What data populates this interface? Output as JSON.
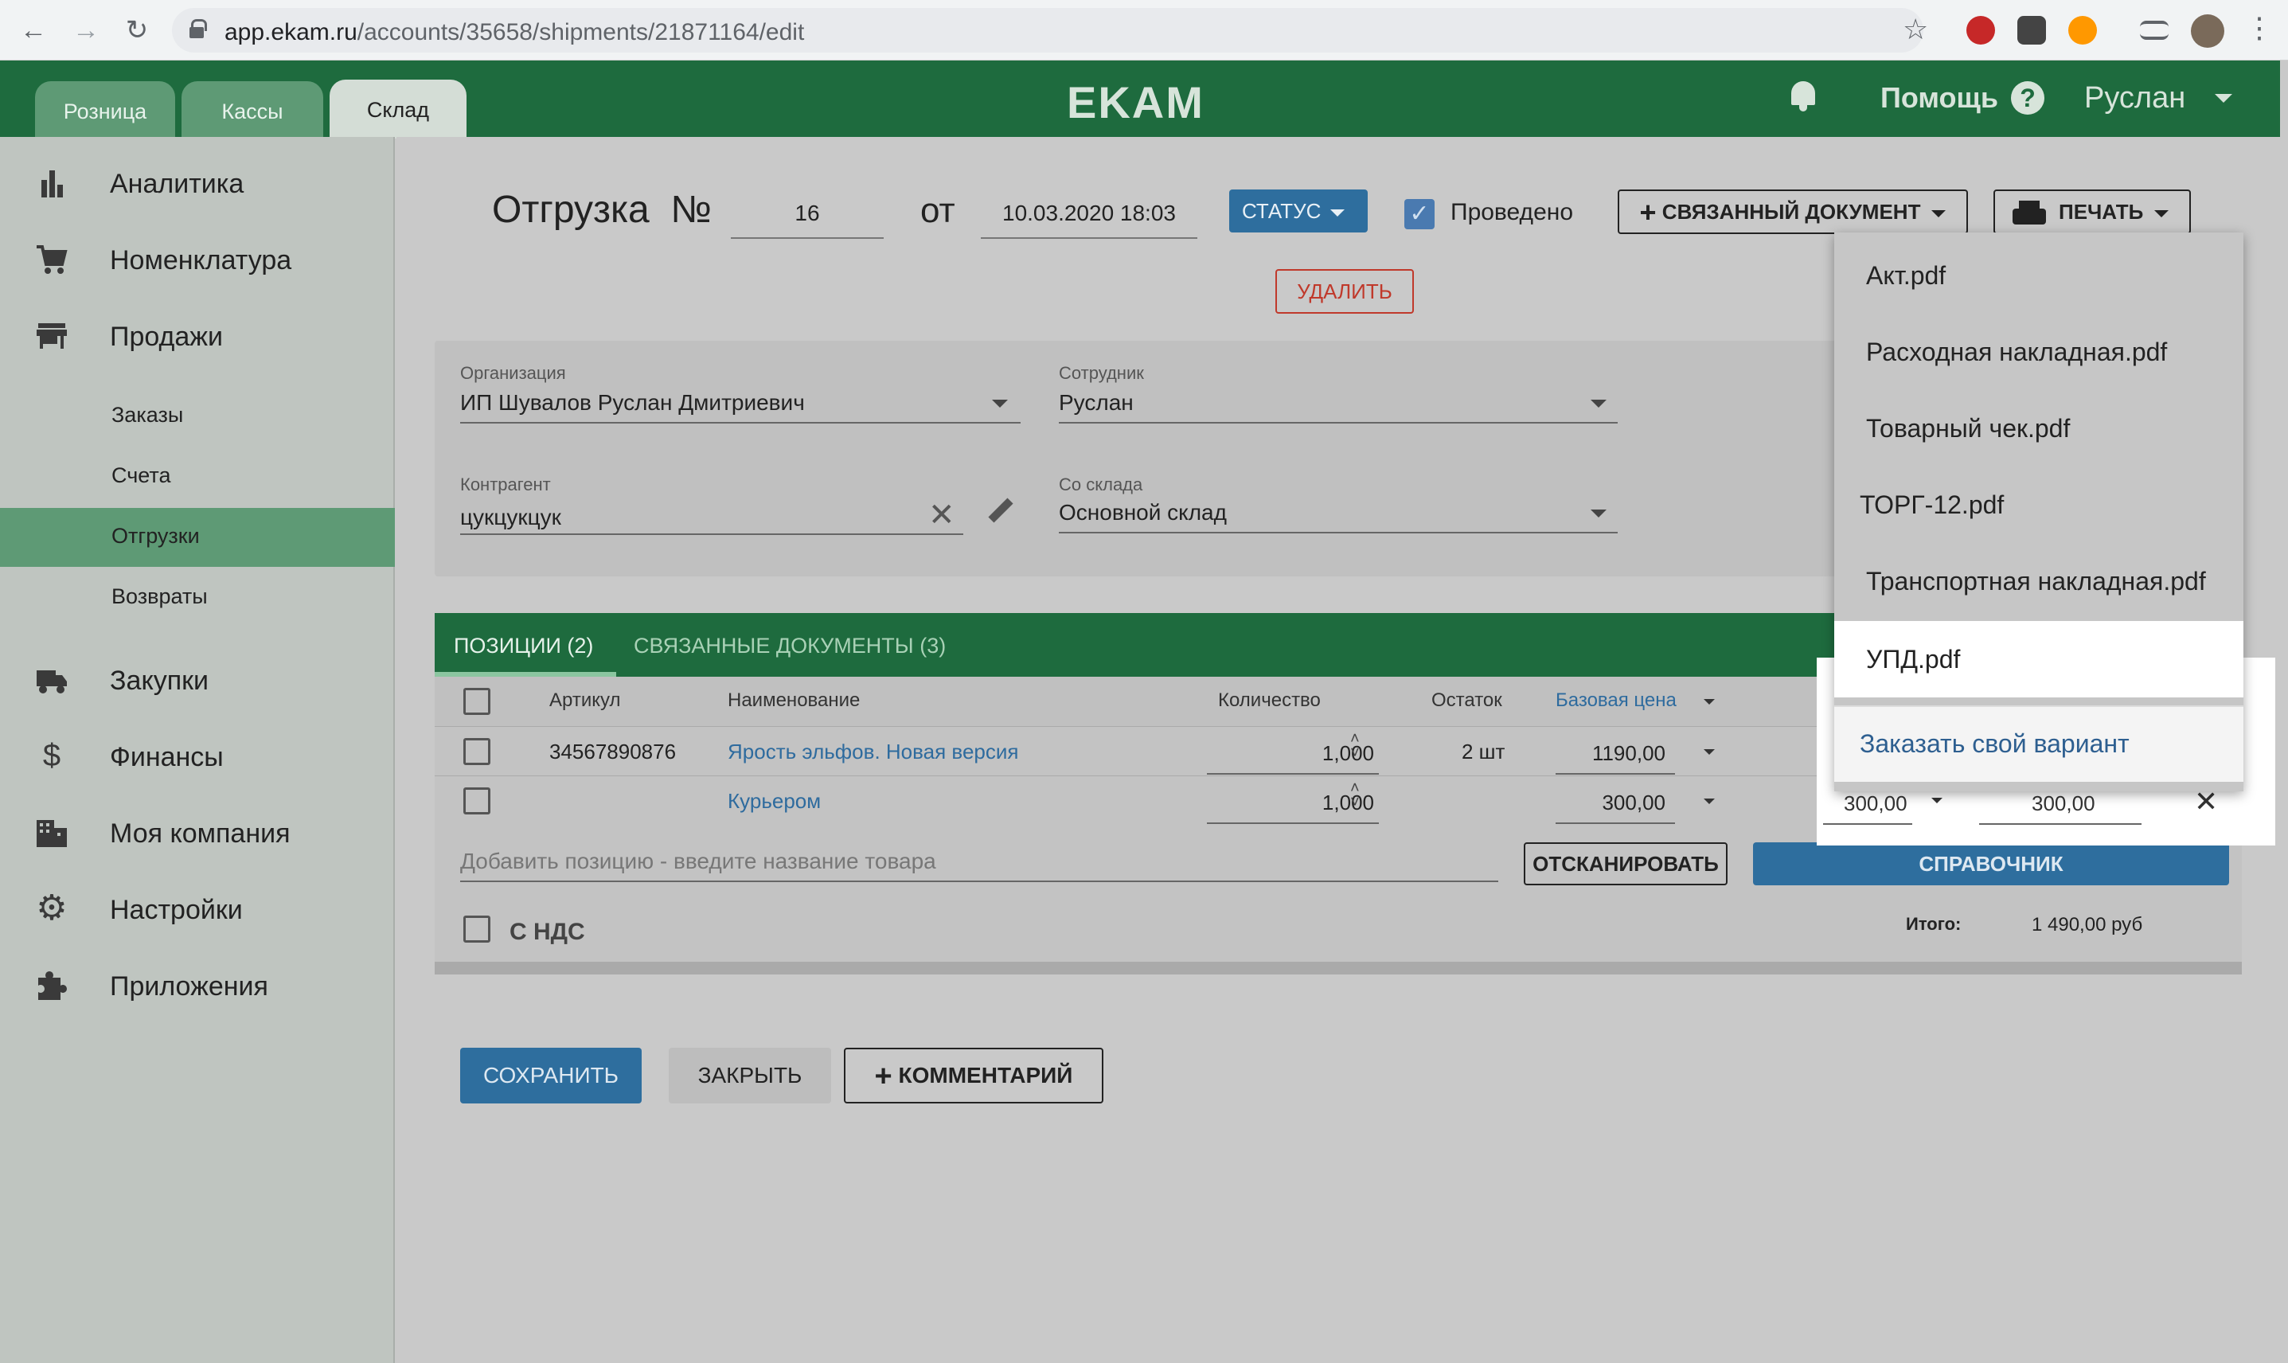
{
  "browser": {
    "url_host": "app.ekam.ru",
    "url_path": "/accounts/35658/shipments/21871164/edit"
  },
  "header": {
    "tabs": [
      "Розница",
      "Кассы",
      "Склад"
    ],
    "logo": "EKAM",
    "help": "Помощь",
    "user": "Руслан"
  },
  "sidebar": {
    "items": [
      {
        "label": "Аналитика",
        "icon": "bar-chart-icon"
      },
      {
        "label": "Номенклатура",
        "icon": "cart-icon"
      },
      {
        "label": "Продажи",
        "icon": "store-icon"
      },
      {
        "label": "Закупки",
        "icon": "truck-icon"
      },
      {
        "label": "Финансы",
        "icon": "dollar-icon"
      },
      {
        "label": "Моя компания",
        "icon": "building-icon"
      },
      {
        "label": "Настройки",
        "icon": "gear-icon"
      },
      {
        "label": "Приложения",
        "icon": "puzzle-icon"
      }
    ],
    "sub_items": [
      "Заказы",
      "Счета",
      "Отгрузки",
      "Возвраты"
    ]
  },
  "doc": {
    "title": "Отгрузка",
    "num_sign": "№",
    "number": "16",
    "from": "от",
    "date": "10.03.2020 18:03",
    "status": "СТАТУС",
    "posted": "Проведено",
    "linked": "СВЯЗАННЫЙ ДОКУМЕНТ",
    "print": "ПЕЧАТЬ",
    "delete": "УДАЛИТЬ"
  },
  "form": {
    "org_label": "Организация",
    "org_value": "ИП Шувалов Руслан Дмитриевич",
    "employee_label": "Сотрудник",
    "employee_value": "Руслан",
    "contractor_label": "Контрагент",
    "contractor_value": "цукцукцук",
    "warehouse_label": "Со склада",
    "warehouse_value": "Основной склад"
  },
  "positions": {
    "tab1": "ПОЗИЦИИ (2)",
    "tab2": "СВЯЗАННЫЕ ДОКУМЕНТЫ (3)",
    "headers": {
      "article": "Артикул",
      "name": "Наименование",
      "qty": "Количество",
      "stock": "Остаток",
      "base_price": "Базовая цена"
    },
    "rows": [
      {
        "article": "34567890876",
        "name": "Ярость эльфов. Новая версия",
        "qty": "1,000",
        "stock": "2 шт",
        "price": "1190,00"
      },
      {
        "article": "",
        "name": "Курьером",
        "qty": "1,000",
        "stock": "",
        "price": "300,00",
        "price2": "300,00",
        "sum": "300,00"
      }
    ],
    "add_placeholder": "Добавить позицию - введите название товара",
    "scan": "ОТСКАНИРОВАТЬ",
    "reference": "СПРАВОЧНИК",
    "vat": "С НДС",
    "total_label": "Итого:",
    "total_value": "1 490,00 руб"
  },
  "actions": {
    "save": "СОХРАНИТЬ",
    "close": "ЗАКРЫТЬ",
    "comment": "КОММЕНТАРИЙ"
  },
  "print_menu": [
    "Акт.pdf",
    "Расходная накладная.pdf",
    "Товарный чек.pdf",
    "ТОРГ-12.pdf",
    "Транспортная накладная.pdf",
    "УПД.pdf",
    "Заказать свой вариант"
  ]
}
